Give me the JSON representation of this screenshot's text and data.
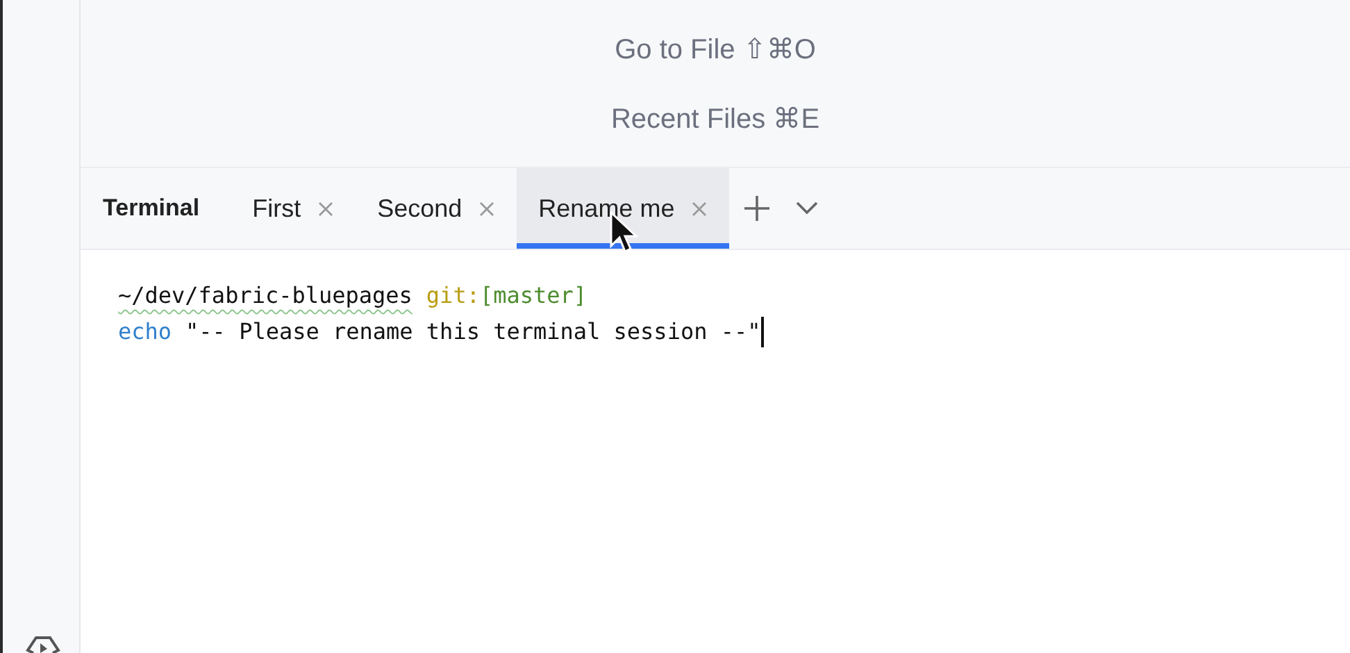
{
  "shortcuts": [
    {
      "label": "Go to File",
      "keys": "⇧⌘O"
    },
    {
      "label": "Recent Files",
      "keys": "⌘E"
    }
  ],
  "terminal": {
    "title": "Terminal",
    "tabs": [
      {
        "label": "First",
        "selected": false
      },
      {
        "label": "Second",
        "selected": false
      },
      {
        "label": "Rename me",
        "selected": true
      }
    ],
    "lines": [
      [
        {
          "kind": "path",
          "text": "~/dev/fabric-bluepages"
        },
        {
          "kind": "git",
          "text": "git:"
        },
        {
          "kind": "branch",
          "text": "[master]"
        }
      ],
      [
        {
          "kind": "command",
          "text": "echo"
        },
        {
          "kind": "plain",
          "text": "\"-- Please rename this terminal session --\""
        }
      ]
    ]
  }
}
